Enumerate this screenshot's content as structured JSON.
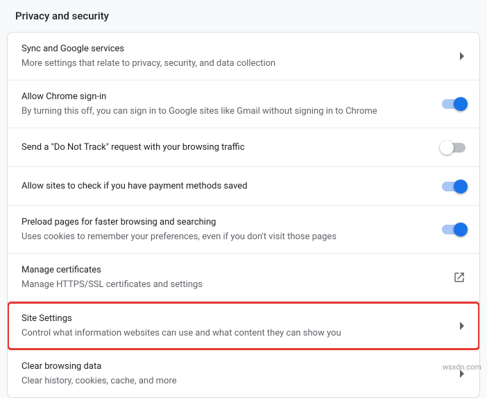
{
  "page": {
    "title": "Privacy and security"
  },
  "rows": {
    "sync": {
      "title": "Sync and Google services",
      "desc": "More settings that relate to privacy, security, and data collection"
    },
    "signin": {
      "title": "Allow Chrome sign-in",
      "desc": "By turning this off, you can sign in to Google sites like Gmail without signing in to Chrome",
      "state": "on"
    },
    "dnt": {
      "title": "Send a \"Do Not Track\" request with your browsing traffic",
      "state": "off"
    },
    "payment": {
      "title": "Allow sites to check if you have payment methods saved",
      "state": "on"
    },
    "preload": {
      "title": "Preload pages for faster browsing and searching",
      "desc": "Uses cookies to remember your preferences, even if you don't visit those pages",
      "state": "on"
    },
    "certs": {
      "title": "Manage certificates",
      "desc": "Manage HTTPS/SSL certificates and settings"
    },
    "site": {
      "title": "Site Settings",
      "desc": "Control what information websites can use and what content they can show you"
    },
    "clear": {
      "title": "Clear browsing data",
      "desc": "Clear history, cookies, cache, and more"
    }
  },
  "watermark": "wsxdn.com"
}
